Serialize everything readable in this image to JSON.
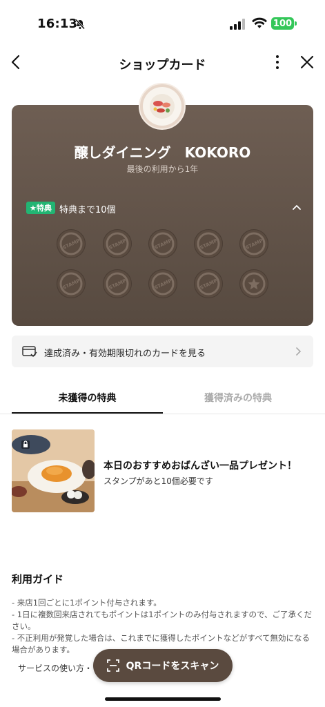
{
  "status_bar": {
    "time": "16:13",
    "battery": "100"
  },
  "header": {
    "title": "ショップカード"
  },
  "card": {
    "shop_name": "醸しダイニング　KOKORO",
    "last_use": "最後の利用から1年",
    "badge": "★特典",
    "reward_text": "特典まで10個",
    "stamp_label": "STAMP",
    "stamps_total": 10,
    "stamps_collected": 0,
    "colors": {
      "card": "#6e5e53",
      "badge": "#22b573"
    }
  },
  "expired_link": {
    "label": "達成済み・有効期限切れのカードを見る"
  },
  "tabs": [
    {
      "label": "未獲得の特典",
      "active": true
    },
    {
      "label": "獲得済みの特典",
      "active": false
    }
  ],
  "reward_item": {
    "title": "本日のおすすめおばんざい一品プレゼント！",
    "subtitle": "スタンプがあと10個必要です"
  },
  "guide": {
    "title": "利用ガイド",
    "lines": [
      "- 来店1回ごとに1ポイント付与されます。",
      "- 1日に複数回来店されてもポイントは1ポイントのみ付与されますので、ご了承ください。",
      "- 不正利用が発覚した場合は、これまでに獲得したポイントなどがすべて無効になる場合があります。"
    ],
    "howto": "サービスの使い方・"
  },
  "qr_button": {
    "label": "QRコードをスキャン"
  }
}
